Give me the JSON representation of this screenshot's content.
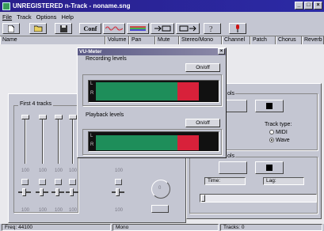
{
  "window": {
    "title": "UNREGISTERED n-Track - noname.sng"
  },
  "menu": [
    "File",
    "Track",
    "Options",
    "Help"
  ],
  "toolbar": {
    "conf_label": "Conf"
  },
  "columns": [
    "Name",
    "Volume",
    "Pan",
    "Mute",
    "Stereo/Mono",
    "Channel",
    "Patch",
    "Chorus",
    "Reverb"
  ],
  "vumeter": {
    "title": "VU-Meter",
    "recording_label": "Recording levels",
    "playback_label": "Playback levels",
    "onoff_label": "On/off",
    "left_label": "L",
    "right_label": "R",
    "recording_level": 0.85,
    "playback_level": 0.85
  },
  "tracks_panel": {
    "title": "First 4 tracks",
    "fader_values": [
      "100",
      "100",
      "100",
      "100"
    ],
    "pan_values": [
      "100",
      "100",
      "100",
      "100"
    ],
    "fifth_fader": "100",
    "fifth_pan": "100",
    "knob_value": "0"
  },
  "rec_panel": {
    "section1_label": "ols",
    "section2_label": "ols",
    "track_type_label": "Track type:",
    "options": [
      "MIDI",
      "Wave"
    ],
    "selected": "Wave",
    "time_label": "Time:",
    "lag_label": "Lag:"
  },
  "status": {
    "freq": "Freq: 44100",
    "mode": "Mono",
    "tracks": "Tracks: 0"
  },
  "colors": {
    "meter_green": "#1e8e5a",
    "meter_red": "#d8213a",
    "titlebar": "#2b2aa5"
  }
}
